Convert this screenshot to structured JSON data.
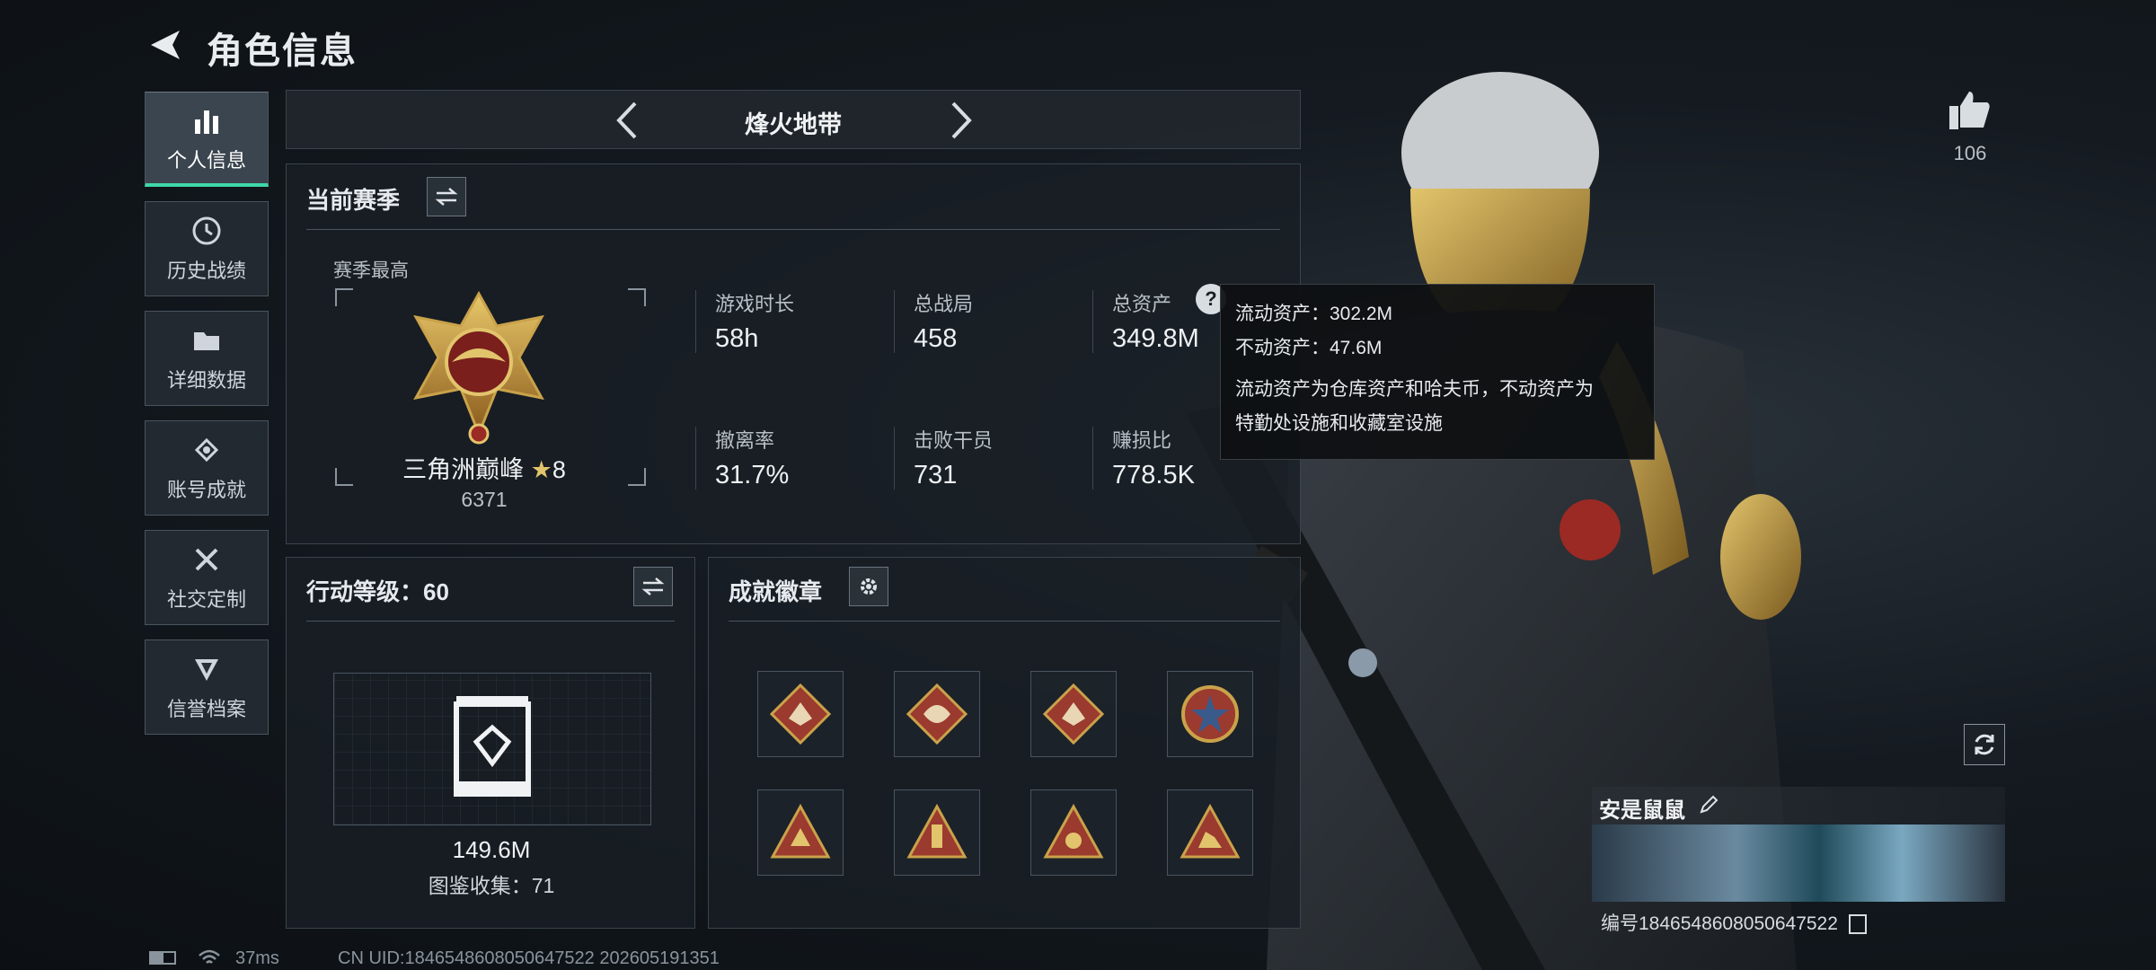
{
  "header": {
    "title": "角色信息"
  },
  "sidebar": {
    "items": [
      {
        "label": "个人信息",
        "icon": "bar-chart-icon"
      },
      {
        "label": "历史战绩",
        "icon": "clock-icon"
      },
      {
        "label": "详细数据",
        "icon": "folder-icon"
      },
      {
        "label": "账号成就",
        "icon": "achievement-icon"
      },
      {
        "label": "社交定制",
        "icon": "tools-icon"
      },
      {
        "label": "信誉档案",
        "icon": "reputation-icon"
      }
    ]
  },
  "mode_selector": {
    "label": "烽火地带"
  },
  "season": {
    "title": "当前赛季",
    "best_label": "赛季最高",
    "rank_name": "三角洲巅峰",
    "rank_stars": "8",
    "rank_score": "6371",
    "stats": [
      {
        "label": "游戏时长",
        "value": "58h"
      },
      {
        "label": "总战局",
        "value": "458"
      },
      {
        "label": "总资产",
        "value": "349.8M"
      },
      {
        "label": "撤离率",
        "value": "31.7%"
      },
      {
        "label": "击败干员",
        "value": "731"
      },
      {
        "label": "赚损比",
        "value": "778.5K"
      }
    ]
  },
  "tooltip": {
    "liquid": "流动资产：302.2M",
    "fixed": "不动资产：47.6M",
    "desc_line1": "流动资产为仓库资产和哈夫币，不动资产为",
    "desc_line2": "特勤处设施和收藏室设施"
  },
  "action_level": {
    "title": "行动等级：60",
    "value": "149.6M",
    "collection": "图鉴收集：71"
  },
  "badges": {
    "title": "成就徽章"
  },
  "likes": {
    "count": "106"
  },
  "profile": {
    "name": "安是鼠鼠",
    "id_text": "编号1846548608050647522"
  },
  "status_bar": {
    "ping": "37ms",
    "uid": "CN UID:1846548608050647522 202605191351"
  },
  "colors": {
    "accent": "#3fd7a8",
    "gold": "#c9a24a",
    "badge_red": "#9b3a2e"
  }
}
